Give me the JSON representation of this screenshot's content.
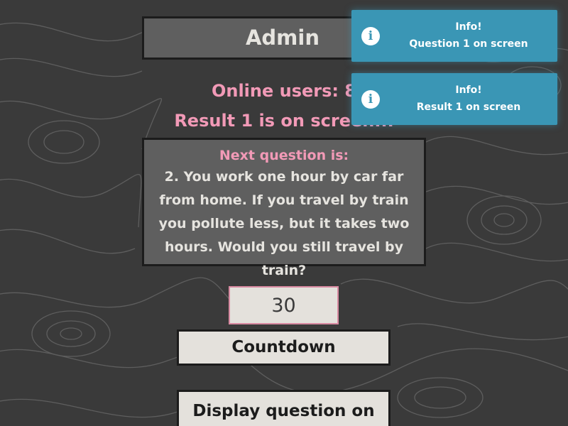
{
  "header": {
    "title": "Admin"
  },
  "status": {
    "online_users": "Online users: 8",
    "result_status": "Result 1 is on screen..."
  },
  "question": {
    "heading": "Next question is:",
    "text": "2. You work one hour by car far from home. If you travel by train you pollute less, but it takes two hours. Would you still travel by train?"
  },
  "countdown": {
    "value": "30"
  },
  "buttons": {
    "countdown_label": "Countdown",
    "display_question_label": "Display question on"
  },
  "notifications": [
    {
      "icon": "info-icon",
      "title": "Info!",
      "message": "Question 1 on screen"
    },
    {
      "icon": "info-icon",
      "title": "Info!",
      "message": "Result 1 on screen"
    }
  ],
  "colors": {
    "background": "#3a3a3a",
    "panel": "#5f5f5f",
    "accent_pink": "#f29ab7",
    "toast_blue": "#3a96b5",
    "button_bg": "#e4e1dc"
  }
}
